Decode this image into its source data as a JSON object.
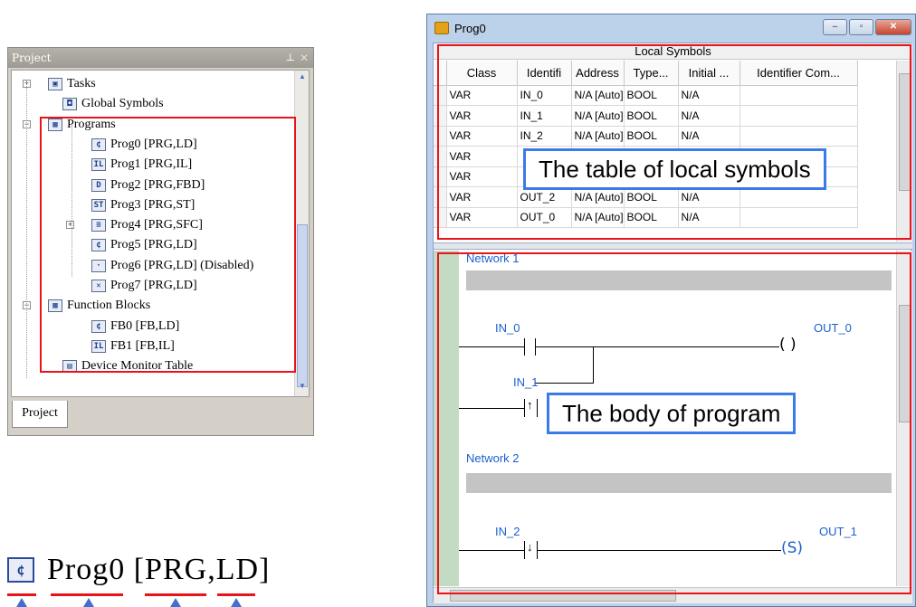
{
  "project_panel": {
    "title": "Project",
    "tab": "Project",
    "items": [
      {
        "label": "Tasks",
        "icon": "tasks-icon",
        "glyph": "▣"
      },
      {
        "label": "Global Symbols",
        "icon": "global-symbols-icon",
        "glyph": "◘"
      },
      {
        "label": "Programs",
        "icon": "programs-icon",
        "glyph": "▦"
      },
      {
        "label": "Prog0 [PRG,LD]",
        "icon": "ld-program-icon",
        "glyph": "¢"
      },
      {
        "label": "Prog1 [PRG,IL]",
        "icon": "il-program-icon",
        "glyph": "IL"
      },
      {
        "label": "Prog2 [PRG,FBD]",
        "icon": "fbd-program-icon",
        "glyph": "D"
      },
      {
        "label": "Prog3 [PRG,ST]",
        "icon": "st-program-icon",
        "glyph": "ST"
      },
      {
        "label": "Prog4 [PRG,SFC]",
        "icon": "sfc-program-icon",
        "glyph": "≡"
      },
      {
        "label": "Prog5 [PRG,LD]",
        "icon": "ld-program-icon",
        "glyph": "¢"
      },
      {
        "label": "Prog6 [PRG,LD] (Disabled)",
        "icon": "disabled-program-icon",
        "glyph": "·"
      },
      {
        "label": "Prog7 [PRG,LD]",
        "icon": "error-program-icon",
        "glyph": "✕"
      },
      {
        "label": "Function Blocks",
        "icon": "function-blocks-icon",
        "glyph": "▦"
      },
      {
        "label": "FB0 [FB,LD]",
        "icon": "ld-fb-icon",
        "glyph": "¢"
      },
      {
        "label": "FB1 [FB,IL]",
        "icon": "il-fb-icon",
        "glyph": "IL"
      },
      {
        "label": "Device Monitor Table",
        "icon": "device-monitor-icon",
        "glyph": "▤"
      }
    ]
  },
  "zoom_label": {
    "glyph": "¢",
    "text": "Prog0 [PRG,LD]"
  },
  "window": {
    "title": "Prog0",
    "controls": {
      "minimize": "–",
      "maximize": "▫",
      "close": "✕"
    },
    "symbols": {
      "header": "Local Symbols",
      "columns": [
        "Class",
        "Identifi",
        "Address",
        "Type...",
        "Initial ...",
        "Identifier Com..."
      ],
      "rows": [
        [
          "VAR",
          "IN_0",
          "N/A [Auto]",
          "BOOL",
          "N/A",
          ""
        ],
        [
          "VAR",
          "IN_1",
          "N/A [Auto]",
          "BOOL",
          "N/A",
          ""
        ],
        [
          "VAR",
          "IN_2",
          "N/A [Auto]",
          "BOOL",
          "N/A",
          ""
        ],
        [
          "VAR",
          "",
          "",
          "",
          "",
          ""
        ],
        [
          "VAR",
          "",
          "",
          "",
          "",
          ""
        ],
        [
          "VAR",
          "OUT_2",
          "N/A [Auto]",
          "BOOL",
          "N/A",
          ""
        ],
        [
          "VAR",
          "OUT_0",
          "N/A [Auto]",
          "BOOL",
          "N/A",
          ""
        ]
      ]
    },
    "body": {
      "network1": "Network 1",
      "network2": "Network 2",
      "in0": "IN_0",
      "in1": "IN_1",
      "in2": "IN_2",
      "out0": "OUT_0",
      "out1": "OUT_1",
      "coil_plain": "(  )",
      "coil_set": "(S)"
    }
  },
  "callouts": {
    "symbols": "The table of local symbols",
    "body": "The body of program"
  },
  "colors": {
    "highlight_box": "#e8141a",
    "callout_border": "#3b7be8",
    "network_label": "#1a60d0"
  }
}
